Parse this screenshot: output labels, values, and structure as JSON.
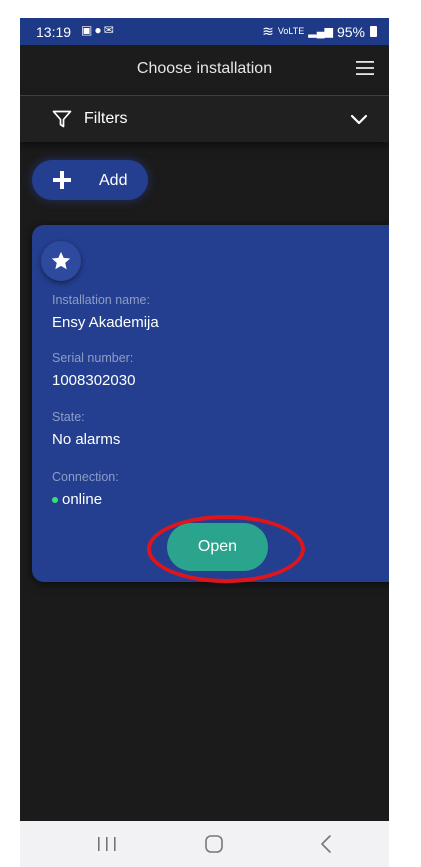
{
  "status_bar": {
    "time": "13:19",
    "left_icons": [
      "image-icon",
      "chat-icon",
      "mail-icon"
    ],
    "network": "VoLTE",
    "battery": "95%"
  },
  "app_bar": {
    "title": "Choose installation",
    "menu_icon": "hamburger-menu-icon"
  },
  "filters": {
    "label": "Filters",
    "expanded": false
  },
  "add_button": {
    "label": "Add"
  },
  "installation_card": {
    "favorite": false,
    "name_label": "Installation name:",
    "name": "Ensy Akademija",
    "serial_label": "Serial number:",
    "serial": "1008302030",
    "state_label": "State:",
    "state": "No alarms",
    "connection_label": "Connection:",
    "connection": "online",
    "connection_color": "#36e07a",
    "open_label": "Open"
  },
  "colors": {
    "accent": "#243f8f",
    "open_button": "#2aa48d",
    "annotation": "#e0151b"
  }
}
